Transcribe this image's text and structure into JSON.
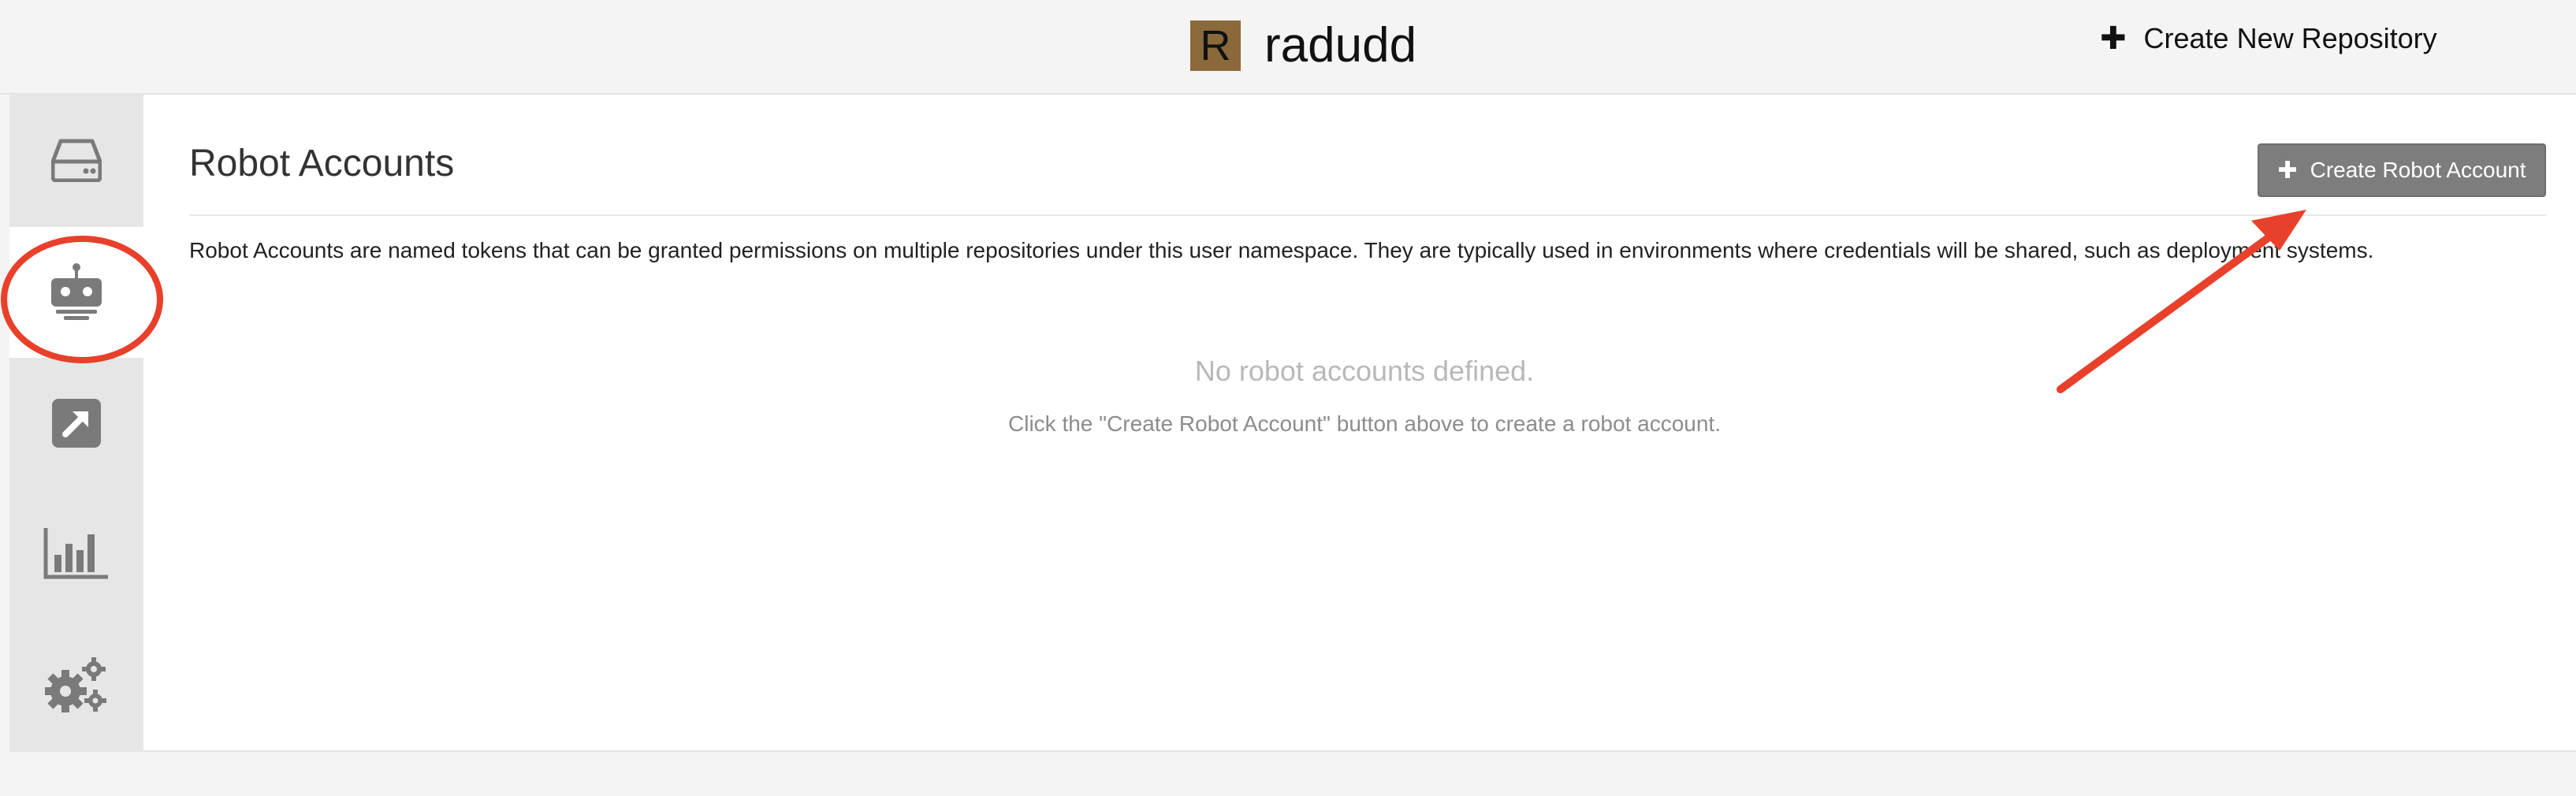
{
  "header": {
    "avatar_letter": "R",
    "namespace": "radudd",
    "create_repo_label": "Create New Repository",
    "create_repo_icon": "plus-icon"
  },
  "sidebar": {
    "items": [
      {
        "name": "repositories",
        "icon": "hard-drive-icon",
        "active": false
      },
      {
        "name": "robot-accounts",
        "icon": "robot-icon",
        "active": true
      },
      {
        "name": "external-logins",
        "icon": "external-link-icon",
        "active": false
      },
      {
        "name": "usage-logs",
        "icon": "bar-chart-icon",
        "active": false
      },
      {
        "name": "settings",
        "icon": "gears-icon",
        "active": false
      }
    ]
  },
  "main": {
    "title": "Robot Accounts",
    "create_button_label": "Create Robot Account",
    "create_button_icon": "plus-icon",
    "description": "Robot Accounts are named tokens that can be granted permissions on multiple repositories under this user namespace. They are typically used in environments where credentials will be shared, such as deployment systems.",
    "empty_title": "No robot accounts defined.",
    "empty_hint": "Click the \"Create Robot Account\" button above to create a robot account."
  },
  "colors": {
    "avatar": "#8a6a3a",
    "button": "#7d7d7d",
    "sidebar": "#e6e6e6",
    "icon": "#7a7a7a",
    "annotation": "#e8402a"
  }
}
